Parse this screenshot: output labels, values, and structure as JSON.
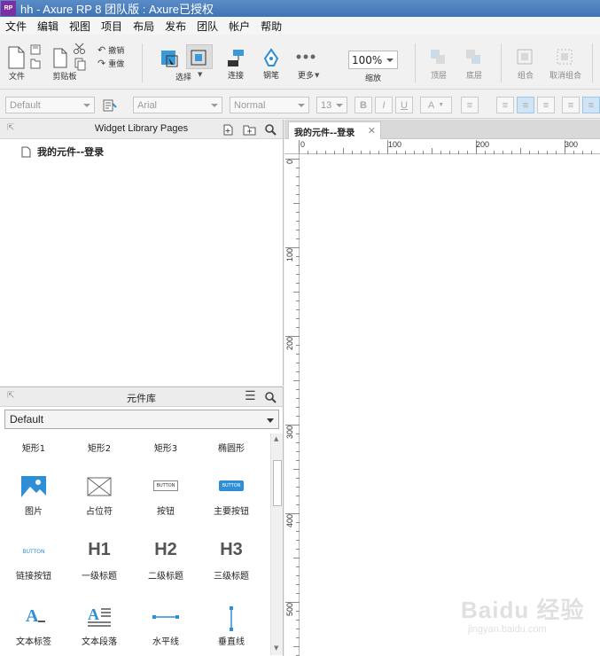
{
  "window": {
    "app_icon": "RP",
    "title": "hh - Axure RP 8 团队版 : Axure已授权"
  },
  "menu": [
    "文件",
    "编辑",
    "视图",
    "项目",
    "布局",
    "发布",
    "团队",
    "帐户",
    "帮助"
  ],
  "toolbar": {
    "file": "文件",
    "clipboard": "剪贴板",
    "undo": "撤销",
    "redo": "重做",
    "select": "选择",
    "connect": "连接",
    "pen": "钢笔",
    "more": "更多",
    "zoom_value": "100%",
    "zoom_label": "缩放",
    "top": "顶层",
    "bottom": "底层",
    "group": "组合",
    "ungroup": "取消组合"
  },
  "format": {
    "style": "Default",
    "font": "Arial",
    "weight": "Normal",
    "size": "13",
    "bold": "B",
    "italic": "I",
    "underline": "U",
    "font_color": "A"
  },
  "pages_panel": {
    "title": "Widget Library Pages",
    "pages": [
      "我的元件--登录"
    ]
  },
  "widgets_panel": {
    "title": "元件库",
    "library": "Default",
    "widgets": [
      {
        "label": "矩形1",
        "icon": "rectangle-icon"
      },
      {
        "label": "矩形2",
        "icon": "rectangle-icon"
      },
      {
        "label": "矩形3",
        "icon": "rectangle-icon"
      },
      {
        "label": "椭圆形",
        "icon": "ellipse-icon"
      },
      {
        "label": "图片",
        "icon": "image-icon"
      },
      {
        "label": "占位符",
        "icon": "placeholder-icon"
      },
      {
        "label": "按钮",
        "icon": "button-icon",
        "text": "BUTTON"
      },
      {
        "label": "主要按钮",
        "icon": "primary-button-icon",
        "text": "BUTTON"
      },
      {
        "label": "链接按钮",
        "icon": "link-button-icon",
        "text": "BUTTON"
      },
      {
        "label": "一级标题",
        "icon": "h1-icon",
        "text": "H1"
      },
      {
        "label": "二级标题",
        "icon": "h2-icon",
        "text": "H2"
      },
      {
        "label": "三级标题",
        "icon": "h3-icon",
        "text": "H3"
      },
      {
        "label": "文本标签",
        "icon": "text-label-icon"
      },
      {
        "label": "文本段落",
        "icon": "text-paragraph-icon"
      },
      {
        "label": "水平线",
        "icon": "horizontal-line-icon"
      },
      {
        "label": "垂直线",
        "icon": "vertical-line-icon"
      }
    ]
  },
  "canvas": {
    "tab": "我的元件--登录",
    "ruler_h": [
      "0",
      "100",
      "200",
      "300"
    ],
    "ruler_v": [
      "0",
      "100",
      "200",
      "300",
      "400",
      "500"
    ]
  },
  "watermark": {
    "brand": "Baidu 经验",
    "url": "jingyan.baidu.com"
  },
  "colors": {
    "accent": "#2f8fd6",
    "title_bar": "#4a7fbf",
    "app_icon": "#7a2fa5"
  }
}
